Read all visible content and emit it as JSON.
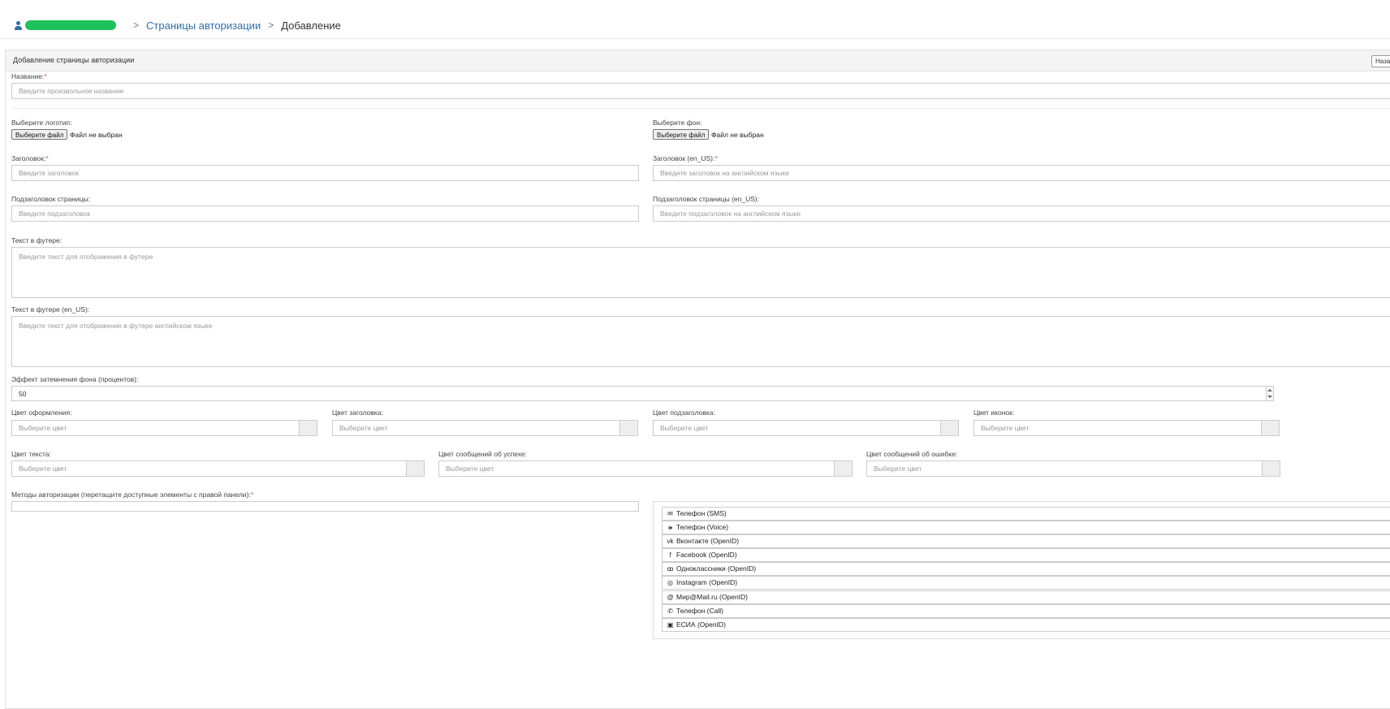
{
  "breadcrumb": {
    "user_icon": "user-icon",
    "section": "Страницы авторизации",
    "current": "Добавление",
    "separator": ">"
  },
  "panel": {
    "title": "Добавление страницы авторизации",
    "header_button": "Назад"
  },
  "form": {
    "name": {
      "label": "Название:",
      "required_mark": "*",
      "placeholder": "Введите произвольное название"
    },
    "logo": {
      "label": "Выберите логотип:",
      "button": "Выберите файл",
      "status": "Файл не выбран"
    },
    "background": {
      "label": "Выберите фон:",
      "button": "Выберите файл",
      "status": "Файл не выбран"
    },
    "title": {
      "label": "Заголовок:",
      "required_mark": "*",
      "placeholder": "Введите заголовок"
    },
    "title_en": {
      "label": "Заголовок (en_US):",
      "required_mark": "*",
      "placeholder": "Введите заголовок на английском языке"
    },
    "subtitle": {
      "label": "Подзаголовок страницы:",
      "placeholder": "Введите подзаголовок"
    },
    "subtitle_en": {
      "label": "Подзаголовок страницы (en_US):",
      "placeholder": "Введите подзаголовок на английском языке"
    },
    "footer": {
      "label": "Текст в футере:",
      "placeholder": "Введите текст для отображения в футере"
    },
    "footer_en": {
      "label": "Текст в футере (en_US):",
      "placeholder": "Введите текст для отображения в футере английском языке"
    },
    "dim": {
      "label": "Эффект затемнения фона (процентов):",
      "value": "50"
    },
    "colors_row1": [
      {
        "label": "Цвет оформления:",
        "placeholder": "Выберите цвет"
      },
      {
        "label": "Цвет заголовка:",
        "placeholder": "Выберите цвет"
      },
      {
        "label": "Цвет подзаголовка:",
        "placeholder": "Выберите цвет"
      },
      {
        "label": "Цвет иконок:",
        "placeholder": "Выберите цвет"
      }
    ],
    "colors_row2": [
      {
        "label": "Цвет текста:",
        "placeholder": "Выберите цвет"
      },
      {
        "label": "Цвет сообщений об успехе:",
        "placeholder": "Выберите цвет"
      },
      {
        "label": "Цвет сообщений об ошибке:",
        "placeholder": "Выберите цвет"
      }
    ],
    "methods": {
      "label": "Методы авторизации (перетащите доступные элементы с правой панели):",
      "required_mark": "*",
      "available": [
        {
          "icon": "envelope-icon",
          "glyph": "✉",
          "label": "Телефон (SMS)"
        },
        {
          "icon": "volume-icon",
          "glyph": "🕪",
          "label": "Телефон (Voice)"
        },
        {
          "icon": "vk-icon",
          "glyph": "vk",
          "label": "Вконтакте (OpenID)"
        },
        {
          "icon": "facebook-icon",
          "glyph": "f",
          "label": "Facebook (OpenID)"
        },
        {
          "icon": "odnoklassniki-icon",
          "glyph": "ꝏ",
          "label": "Одноклассники (OpenID)"
        },
        {
          "icon": "instagram-icon",
          "glyph": "◎",
          "label": "Instagram (OpenID)"
        },
        {
          "icon": "at-icon",
          "glyph": "@",
          "label": "Мир@Mail.ru (OpenID)"
        },
        {
          "icon": "phone-call-icon",
          "glyph": "✆",
          "label": "Телефон (Call)"
        },
        {
          "icon": "id-card-icon",
          "glyph": "▣",
          "label": "ЕСИА (OpenID)"
        }
      ]
    }
  },
  "colors": {
    "link": "#2f6fa8",
    "required": "#d9534f",
    "redaction": "#1fc15a"
  }
}
